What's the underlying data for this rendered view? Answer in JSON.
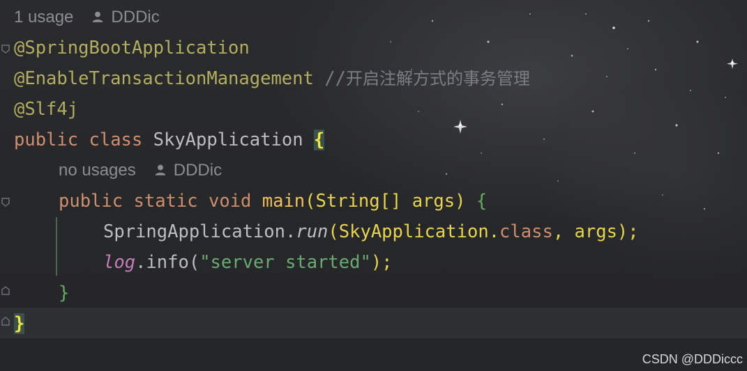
{
  "inlay_hints": {
    "class_usages": "1 usage",
    "class_author": "DDDic",
    "method_usages": "no usages",
    "method_author": "DDDic"
  },
  "code": {
    "line1_annotation": "@SpringBootApplication",
    "line2_annotation": "@EnableTransactionManagement",
    "line2_comment_prefix": "//",
    "line2_comment_text": "开启注解方式的事务管理",
    "line3_annotation": "@Slf4j",
    "line4_kw_public": "public",
    "line4_kw_class": "class",
    "line4_class_name": "SkyApplication",
    "line4_brace": "{",
    "line5_kw_public": "public",
    "line5_kw_static": "static",
    "line5_kw_void": "void",
    "line5_method": "main",
    "line5_params_open": "(String[] args)",
    "line5_brace": "{",
    "line6_receiver": "SpringApplication.",
    "line6_method": "run",
    "line6_args_open": "(SkyApplication.",
    "line6_kw_class": "class",
    "line6_args_close": ", args);",
    "line7_field": "log",
    "line7_call": ".info(",
    "line7_string": "\"server started\"",
    "line7_close": ");",
    "line8_brace": "}",
    "line9_brace": "}"
  },
  "watermark": "CSDN @DDDiccc"
}
